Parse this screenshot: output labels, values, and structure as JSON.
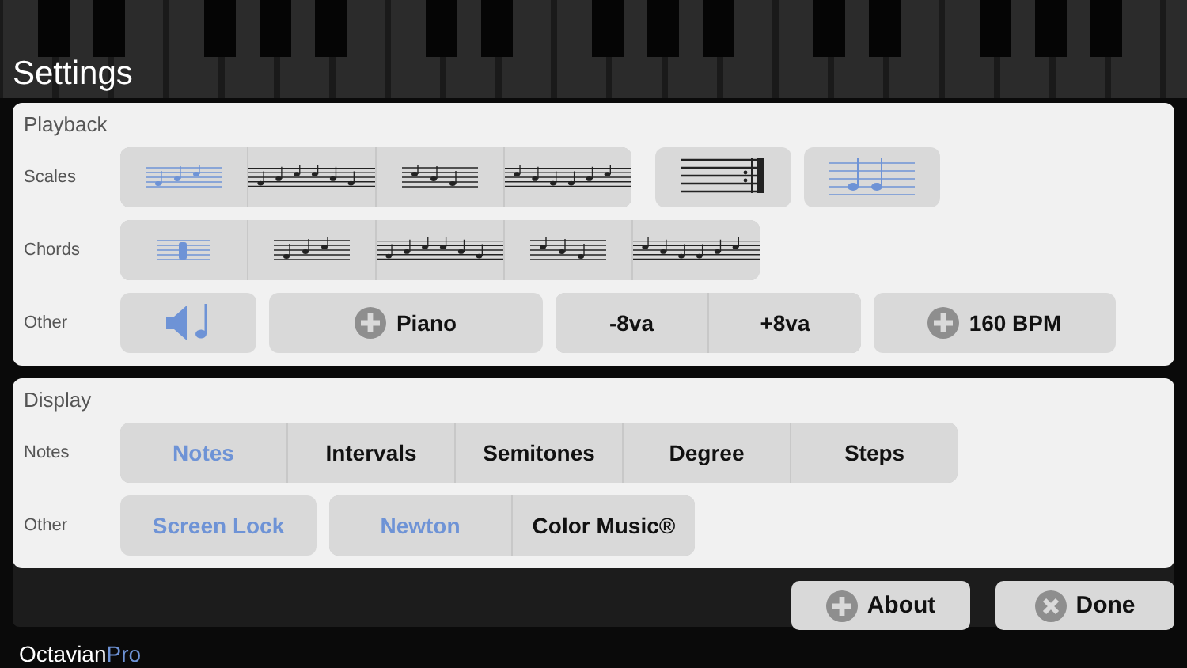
{
  "title": "Settings",
  "playback": {
    "heading": "Playback",
    "scales": {
      "label": "Scales",
      "groups": [
        [
          {
            "kind": "scale",
            "selected": true
          },
          {
            "kind": "scale",
            "selected": false
          },
          {
            "kind": "scale",
            "selected": false
          },
          {
            "kind": "scale",
            "selected": false
          }
        ],
        [
          {
            "kind": "repeat",
            "selected": false
          }
        ],
        [
          {
            "kind": "tied",
            "selected": true
          }
        ]
      ]
    },
    "chords": {
      "label": "Chords",
      "options": [
        {
          "kind": "chord",
          "selected": true
        },
        {
          "kind": "scale",
          "selected": false
        },
        {
          "kind": "scale",
          "selected": false
        },
        {
          "kind": "scale",
          "selected": false
        },
        {
          "kind": "scale",
          "selected": false
        }
      ]
    },
    "other": {
      "label": "Other",
      "sound": {
        "on": true
      },
      "instrument": "Piano",
      "octaves": [
        {
          "label": "-8va",
          "selected": false
        },
        {
          "label": "+8va",
          "selected": false
        }
      ],
      "tempo": "160 BPM"
    }
  },
  "display": {
    "heading": "Display",
    "notes": {
      "label": "Notes",
      "options": [
        {
          "label": "Notes",
          "selected": true
        },
        {
          "label": "Intervals",
          "selected": false
        },
        {
          "label": "Semitones",
          "selected": false
        },
        {
          "label": "Degree",
          "selected": false
        },
        {
          "label": "Steps",
          "selected": false
        }
      ]
    },
    "other": {
      "label": "Other",
      "screen_lock": {
        "label": "Screen Lock",
        "selected": true
      },
      "colors": [
        {
          "label": "Newton",
          "selected": true
        },
        {
          "label": "Color Music®",
          "selected": false
        }
      ]
    }
  },
  "buttons": [
    {
      "label": "About",
      "kind": "plus"
    },
    {
      "label": "Done",
      "kind": "close"
    }
  ],
  "brand": {
    "name": "Octavian",
    "suffix": "Pro"
  }
}
